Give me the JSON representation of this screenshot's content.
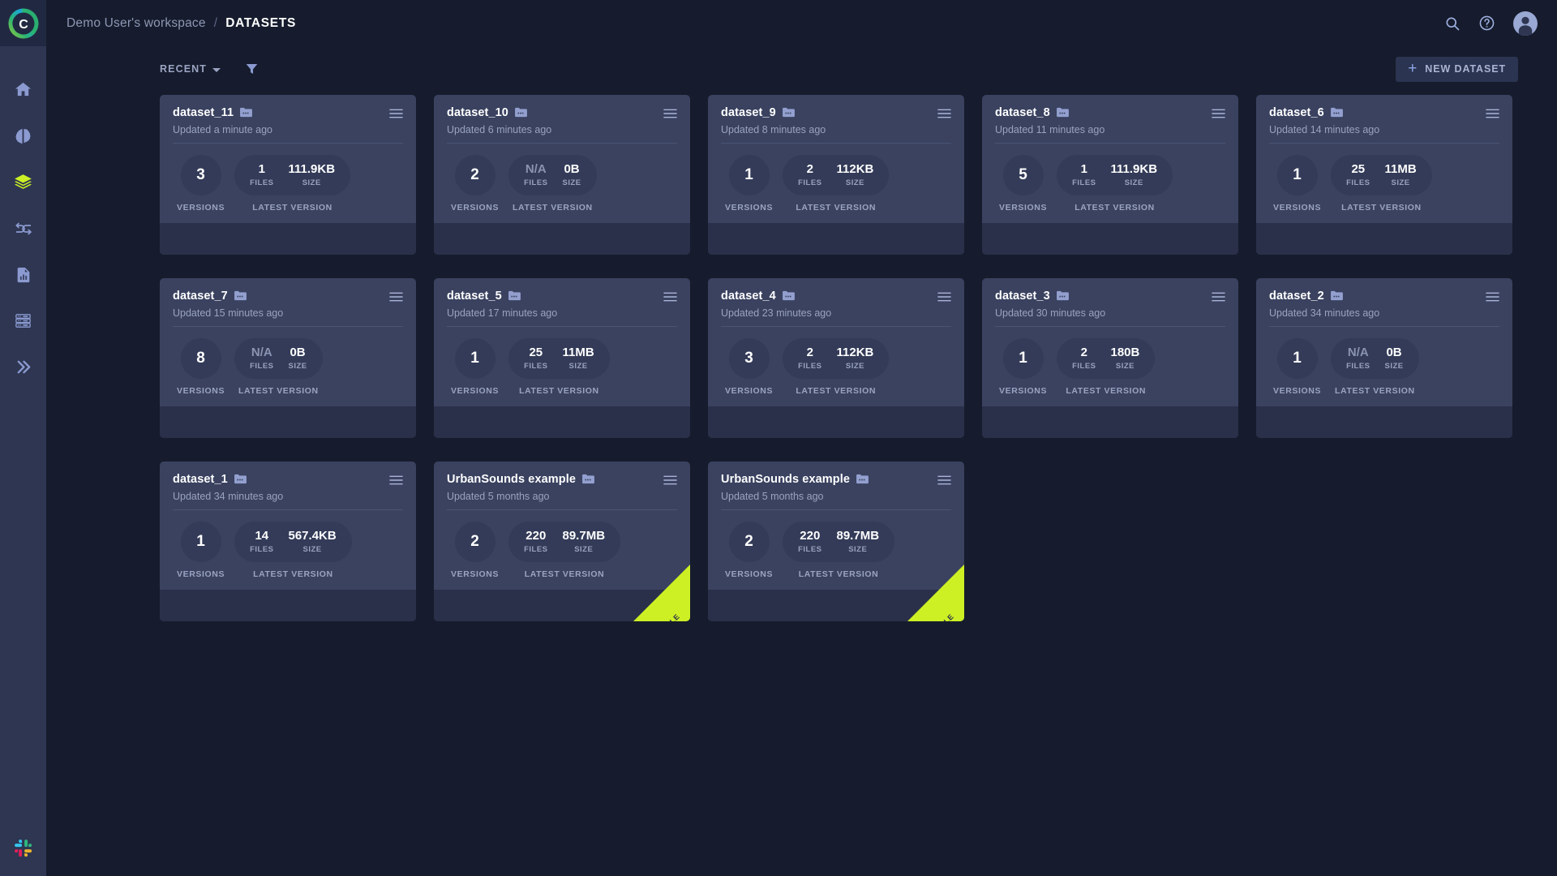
{
  "brand": {
    "logo_letter": "C",
    "accent": "#ccf024",
    "sidebar_bg": "#2e3652",
    "page_bg": "#161c2d",
    "card_bg": "#3a4260",
    "card_footer_bg": "#2a3049"
  },
  "header": {
    "workspace": "Demo User's workspace",
    "separator": "/",
    "current": "DATASETS",
    "search_icon": "search-icon",
    "help_icon": "help-circle-icon",
    "avatar_icon": "user-avatar"
  },
  "sidebar": {
    "items": [
      {
        "name": "home",
        "icon": "home-icon",
        "active": false
      },
      {
        "name": "experiments",
        "icon": "brain-icon",
        "active": false
      },
      {
        "name": "datasets",
        "icon": "layers-icon",
        "active": true
      },
      {
        "name": "workflows",
        "icon": "shuffle-arrows-icon",
        "active": false
      },
      {
        "name": "reports",
        "icon": "report-chart-icon",
        "active": false
      },
      {
        "name": "resources",
        "icon": "server-rack-icon",
        "active": false
      },
      {
        "name": "pipelines",
        "icon": "double-chevron-right-icon",
        "active": false
      }
    ],
    "bottom": {
      "name": "slack",
      "icon": "slack-icon"
    }
  },
  "toolbar": {
    "sort_label": "RECENT",
    "sort_caret_icon": "chevron-down-icon",
    "filter_icon": "funnel-filter-icon",
    "new_dataset_label": "NEW DATASET",
    "new_dataset_plus": "+"
  },
  "card_labels": {
    "versions": "VERSIONS",
    "files": "FILES",
    "size": "SIZE",
    "latest_version": "LATEST VERSION",
    "folder_icon": "folder-dots-icon",
    "menu_icon": "hamburger-menu-icon",
    "ribbon_text": "EXAMPLE"
  },
  "datasets": [
    {
      "title": "dataset_11",
      "updated": "Updated a minute ago",
      "versions": "3",
      "files": "1",
      "size": "111.9KB",
      "files_na": false,
      "example": false
    },
    {
      "title": "dataset_10",
      "updated": "Updated 6 minutes ago",
      "versions": "2",
      "files": "N/A",
      "size": "0B",
      "files_na": true,
      "example": false
    },
    {
      "title": "dataset_9",
      "updated": "Updated 8 minutes ago",
      "versions": "1",
      "files": "2",
      "size": "112KB",
      "files_na": false,
      "example": false
    },
    {
      "title": "dataset_8",
      "updated": "Updated 11 minutes ago",
      "versions": "5",
      "files": "1",
      "size": "111.9KB",
      "files_na": false,
      "example": false
    },
    {
      "title": "dataset_6",
      "updated": "Updated 14 minutes ago",
      "versions": "1",
      "files": "25",
      "size": "11MB",
      "files_na": false,
      "example": false
    },
    {
      "title": "dataset_7",
      "updated": "Updated 15 minutes ago",
      "versions": "8",
      "files": "N/A",
      "size": "0B",
      "files_na": true,
      "example": false
    },
    {
      "title": "dataset_5",
      "updated": "Updated 17 minutes ago",
      "versions": "1",
      "files": "25",
      "size": "11MB",
      "files_na": false,
      "example": false
    },
    {
      "title": "dataset_4",
      "updated": "Updated 23 minutes ago",
      "versions": "3",
      "files": "2",
      "size": "112KB",
      "files_na": false,
      "example": false
    },
    {
      "title": "dataset_3",
      "updated": "Updated 30 minutes ago",
      "versions": "1",
      "files": "2",
      "size": "180B",
      "files_na": false,
      "example": false
    },
    {
      "title": "dataset_2",
      "updated": "Updated 34 minutes ago",
      "versions": "1",
      "files": "N/A",
      "size": "0B",
      "files_na": true,
      "example": false
    },
    {
      "title": "dataset_1",
      "updated": "Updated 34 minutes ago",
      "versions": "1",
      "files": "14",
      "size": "567.4KB",
      "files_na": false,
      "example": false
    },
    {
      "title": "UrbanSounds example",
      "updated": "Updated 5 months ago",
      "versions": "2",
      "files": "220",
      "size": "89.7MB",
      "files_na": false,
      "example": true
    },
    {
      "title": "UrbanSounds example",
      "updated": "Updated 5 months ago",
      "versions": "2",
      "files": "220",
      "size": "89.7MB",
      "files_na": false,
      "example": true
    }
  ]
}
